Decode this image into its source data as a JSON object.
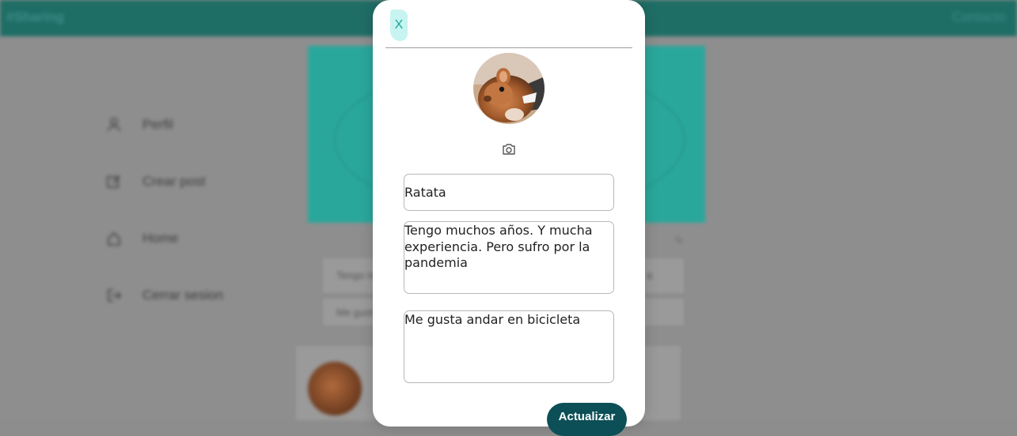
{
  "background": {
    "brand": "#Sharing",
    "nav_contact": "Contacto",
    "menu": [
      {
        "label": "Perfil",
        "icon": "user-icon"
      },
      {
        "label": "Crear post",
        "icon": "edit-icon"
      },
      {
        "label": "Home",
        "icon": "home-icon"
      },
      {
        "label": "Cerrar sesion",
        "icon": "logout-icon"
      }
    ],
    "card_texts": [
      "Tengo m",
      "Me gust",
      "a"
    ]
  },
  "modal": {
    "close_label": "X",
    "camera_icon": "camera-icon",
    "name_value": "Ratata",
    "bio_value": "Tengo muchos años. Y mucha experiencia. Pero sufro por la pandemia",
    "hobby_value": "Me gusta andar en bicicleta",
    "update_label": "Actualizar"
  },
  "colors": {
    "topbar": "#1f6e66",
    "banner": "#2aa79b",
    "close_bg": "#c7f4f0",
    "close_text": "#16a99c",
    "update_button": "#0c4f56"
  }
}
